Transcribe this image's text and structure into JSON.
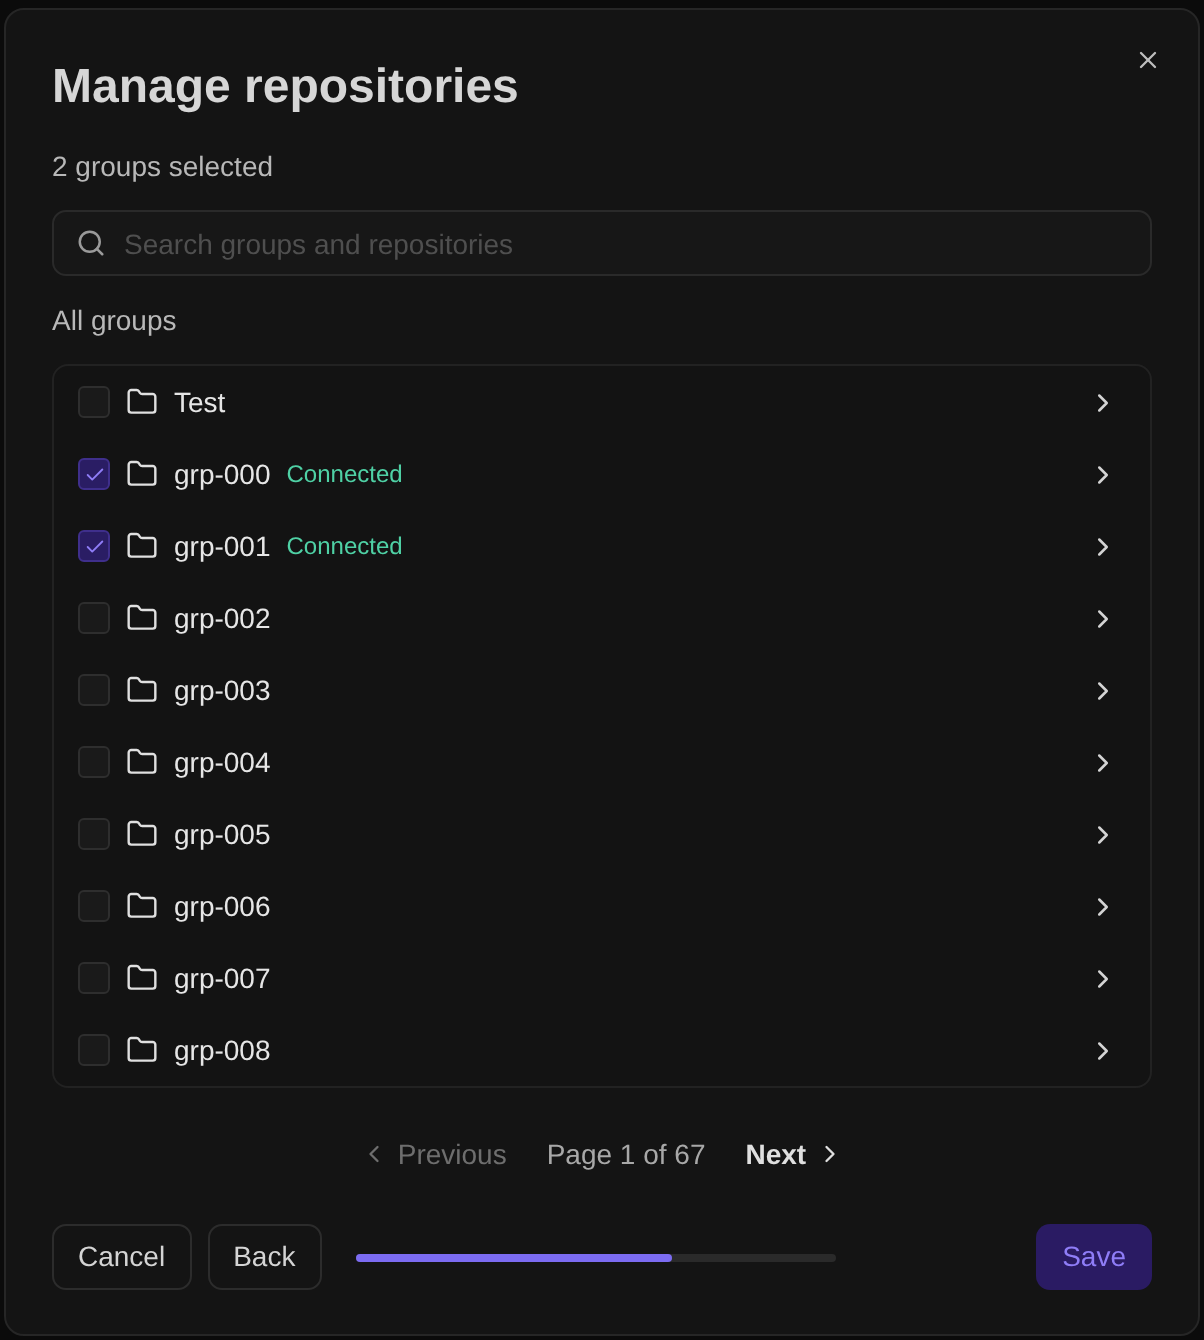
{
  "dialog": {
    "title": "Manage repositories",
    "selection_summary": "2 groups selected",
    "search": {
      "placeholder": "Search groups and repositories"
    },
    "list_heading": "All groups",
    "groups": [
      {
        "name": "Test",
        "checked": false
      },
      {
        "name": "grp-000",
        "checked": true,
        "status": "Connected"
      },
      {
        "name": "grp-001",
        "checked": true,
        "status": "Connected"
      },
      {
        "name": "grp-002",
        "checked": false
      },
      {
        "name": "grp-003",
        "checked": false
      },
      {
        "name": "grp-004",
        "checked": false
      },
      {
        "name": "grp-005",
        "checked": false
      },
      {
        "name": "grp-006",
        "checked": false
      },
      {
        "name": "grp-007",
        "checked": false
      },
      {
        "name": "grp-008",
        "checked": false
      }
    ],
    "pagination": {
      "previous": {
        "label": "Previous",
        "disabled": true
      },
      "page_info": "Page 1 of 67",
      "next": {
        "label": "Next",
        "disabled": false
      }
    },
    "footer": {
      "buttons": [
        {
          "label": "Cancel",
          "kind": "secondary"
        },
        {
          "label": "Back",
          "kind": "secondary"
        },
        {
          "label": "Save",
          "kind": "primary"
        }
      ],
      "progress": {
        "level": 0.66
      }
    }
  }
}
